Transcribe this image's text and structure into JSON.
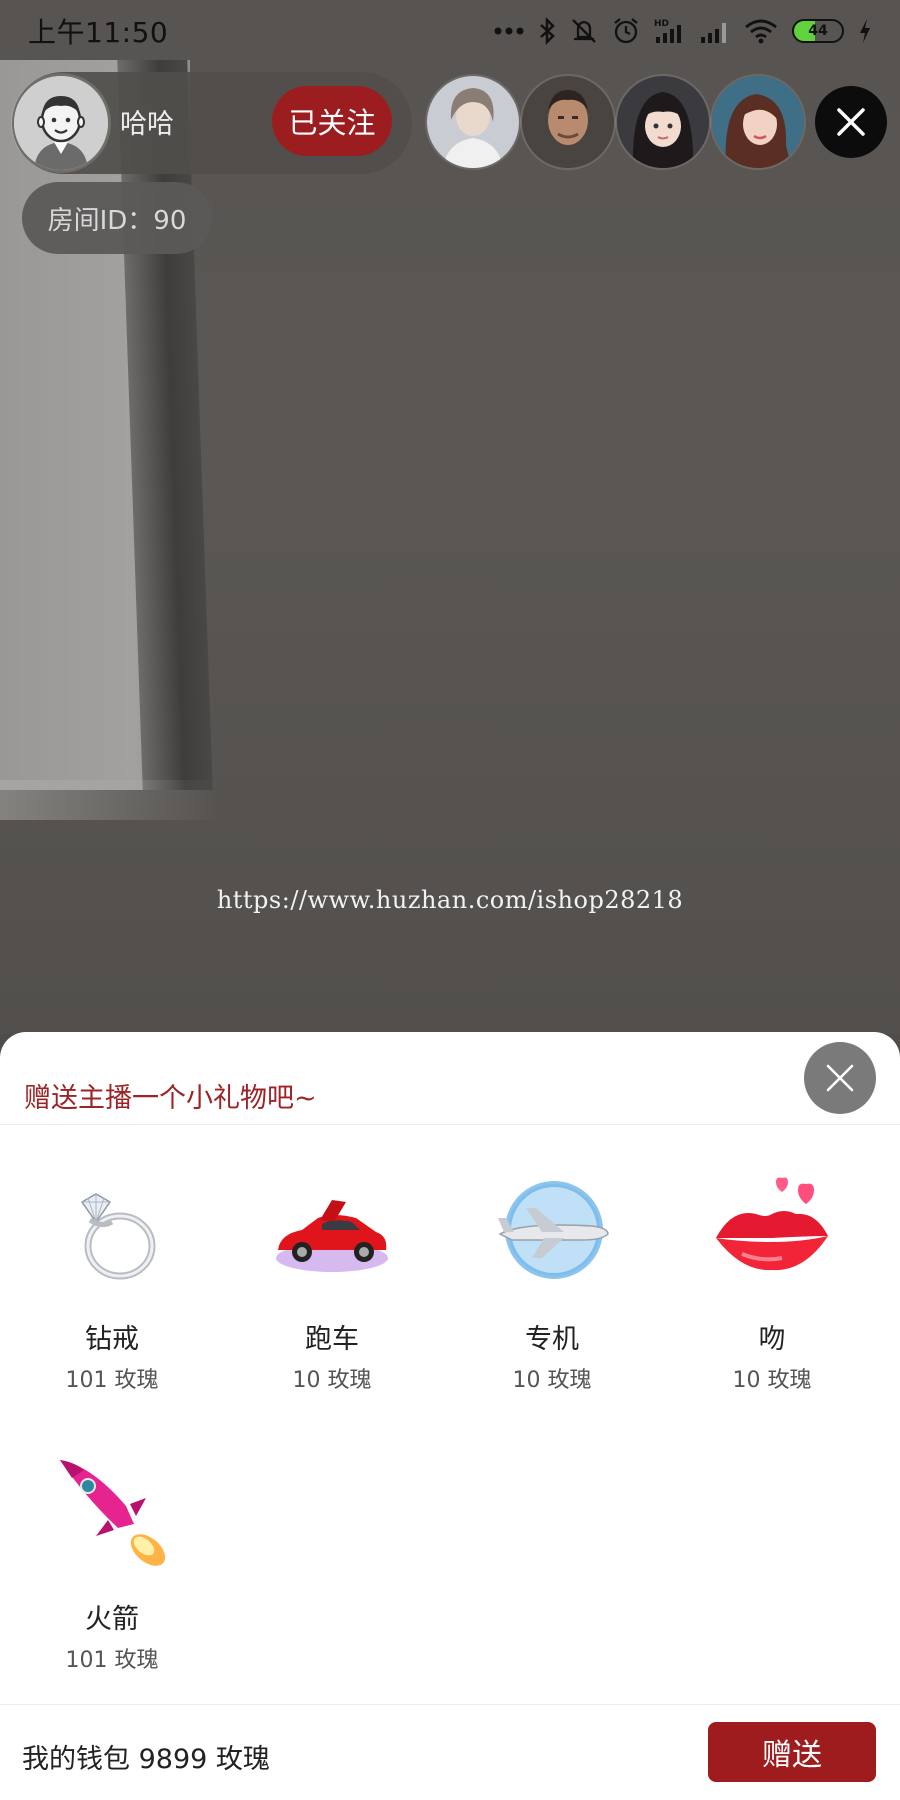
{
  "status_bar": {
    "time": "上午11:50",
    "battery": "44",
    "icons": [
      "more-dots-icon",
      "bluetooth-icon",
      "mute-icon",
      "alarm-icon",
      "hd-signal-icon",
      "signal-icon",
      "wifi-icon",
      "battery-icon",
      "charging-icon"
    ]
  },
  "host": {
    "name": "哈哈",
    "follow_label": "已关注",
    "room_id": "房间ID：90"
  },
  "viewers": [
    {
      "name": "viewer-1"
    },
    {
      "name": "viewer-2"
    },
    {
      "name": "viewer-3"
    },
    {
      "name": "viewer-4"
    }
  ],
  "watermark": "https://www.huzhan.com/ishop28218",
  "gift_panel": {
    "title": "赠送主播一个小礼物吧~",
    "gifts": [
      {
        "name": "钻戒",
        "price": "101 玫瑰",
        "icon": "diamond-ring-icon"
      },
      {
        "name": "跑车",
        "price": "10 玫瑰",
        "icon": "sports-car-icon"
      },
      {
        "name": "专机",
        "price": "10 玫瑰",
        "icon": "airplane-icon"
      },
      {
        "name": "吻",
        "price": "10 玫瑰",
        "icon": "kiss-lips-icon"
      },
      {
        "name": "火箭",
        "price": "101 玫瑰",
        "icon": "rocket-icon"
      }
    ],
    "wallet": "我的钱包 9899 玫瑰",
    "send_label": "赠送"
  },
  "colors": {
    "accent": "#9d2426",
    "send_button": "#9e1c1e",
    "panel_bg": "#ffffff"
  }
}
